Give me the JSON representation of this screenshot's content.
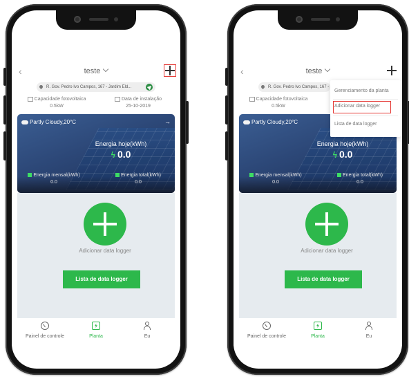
{
  "left": {
    "header": {
      "title": "teste"
    },
    "address": "R. Gov. Pedro Ivo Campos, 167 - Jardim Eld...",
    "info": {
      "capacity_label": "Capacidade fotovoltaica",
      "capacity_value": "0.5kW",
      "install_label": "Data de instalação",
      "install_value": "25-10-2019"
    },
    "card": {
      "weather": "Partly Cloudy,20°C",
      "today_label": "Energia hoje(kWh)",
      "today_value": "0.0",
      "monthly_label": "Energia mensal(kWh)",
      "monthly_value": "0.0",
      "total_label": "Energia total(kWh)",
      "total_value": "0.0"
    },
    "add_logger_label": "Adicionar data logger",
    "list_button": "Lista de data logger",
    "tabs": {
      "dashboard": "Painel de controle",
      "plant": "Planta",
      "me": "Eu"
    }
  },
  "right": {
    "header": {
      "title": "teste"
    },
    "address": "R. Gov. Pedro Ivo Campos, 167 - Jardim Eld...",
    "info": {
      "capacity_label": "Capacidade fotovoltaica",
      "capacity_value": "0.5kW"
    },
    "card": {
      "weather": "Partly Cloudy,20°C",
      "today_label": "Energia hoje(kWh)",
      "today_value": "0.0",
      "monthly_label": "Energia mensal(kWh)",
      "monthly_value": "0.0",
      "total_label": "Energia total(kWh)",
      "total_value": "0.0"
    },
    "add_logger_label": "Adicionar data logger",
    "list_button": "Lista de data logger",
    "tabs": {
      "dashboard": "Painel de controle",
      "plant": "Planta",
      "me": "Eu"
    },
    "menu": {
      "items": [
        "Gerenciamento da planta",
        "Adicionar data logger",
        "Lista de data logger"
      ]
    }
  },
  "colors": {
    "accent": "#2db84b",
    "highlight": "#e53935",
    "card": "#2c4777",
    "content_bg": "#e6ebef"
  }
}
